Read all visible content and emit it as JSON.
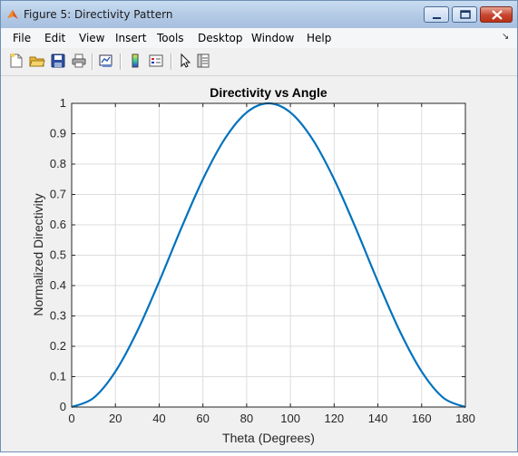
{
  "window": {
    "title": "Figure 5: Directivity Pattern"
  },
  "menu": {
    "items": [
      "File",
      "Edit",
      "View",
      "Insert",
      "Tools",
      "Desktop",
      "Window",
      "Help"
    ]
  },
  "toolbar": {
    "icons": [
      "new-figure-icon",
      "open-file-icon",
      "save-icon",
      "print-icon",
      "link-plot-icon",
      "colorbar-icon",
      "legend-icon",
      "pointer-icon",
      "property-inspector-icon"
    ]
  },
  "chart_data": {
    "type": "line",
    "title": "Directivity vs Angle",
    "xlabel": "Theta (Degrees)",
    "ylabel": "Normalized Directivity",
    "xlim": [
      0,
      180
    ],
    "ylim": [
      0,
      1
    ],
    "xticks": [
      "0",
      "20",
      "40",
      "60",
      "80",
      "100",
      "120",
      "140",
      "160",
      "180"
    ],
    "yticks": [
      "0",
      "0.1",
      "0.2",
      "0.3",
      "0.4",
      "0.5",
      "0.6",
      "0.7",
      "0.8",
      "0.9",
      "1"
    ],
    "grid": true,
    "series": [
      {
        "color": "#0072bd",
        "x": [
          0,
          10,
          20,
          30,
          40,
          50,
          60,
          70,
          80,
          90,
          100,
          110,
          120,
          130,
          140,
          150,
          160,
          170,
          180
        ],
        "y": [
          0,
          0.03,
          0.117,
          0.25,
          0.413,
          0.587,
          0.75,
          0.883,
          0.97,
          1,
          0.97,
          0.883,
          0.75,
          0.587,
          0.413,
          0.25,
          0.117,
          0.03,
          0
        ]
      }
    ]
  }
}
